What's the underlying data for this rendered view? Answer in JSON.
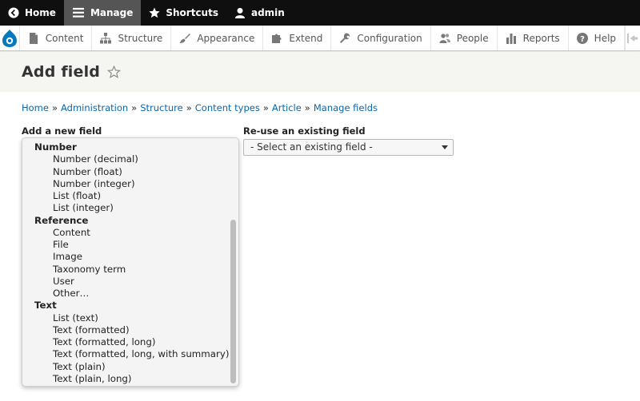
{
  "toolbar": {
    "home": "Home",
    "manage": "Manage",
    "shortcuts": "Shortcuts",
    "user": "admin"
  },
  "tray": {
    "items": [
      {
        "label": "Content",
        "icon": "file-icon"
      },
      {
        "label": "Structure",
        "icon": "sitemap-icon"
      },
      {
        "label": "Appearance",
        "icon": "paintbrush-icon"
      },
      {
        "label": "Extend",
        "icon": "puzzle-icon"
      },
      {
        "label": "Configuration",
        "icon": "wrench-icon"
      },
      {
        "label": "People",
        "icon": "people-icon"
      },
      {
        "label": "Reports",
        "icon": "bar-chart-icon"
      },
      {
        "label": "Help",
        "icon": "help-icon"
      }
    ]
  },
  "page": {
    "title": "Add field"
  },
  "breadcrumb": [
    "Home",
    "Administration",
    "Structure",
    "Content types",
    "Article",
    "Manage fields"
  ],
  "breadcrumb_separator": "»",
  "form": {
    "add_new_label": "Add a new field",
    "reuse_label": "Re-use an existing field",
    "reuse_selected": "- Select an existing field -"
  },
  "dropdown": {
    "rows": [
      {
        "type": "group",
        "label": "Number"
      },
      {
        "type": "option",
        "label": "Number (decimal)"
      },
      {
        "type": "option",
        "label": "Number (float)"
      },
      {
        "type": "option",
        "label": "Number (integer)"
      },
      {
        "type": "option",
        "label": "List (float)"
      },
      {
        "type": "option",
        "label": "List (integer)"
      },
      {
        "type": "group",
        "label": "Reference"
      },
      {
        "type": "option",
        "label": "Content"
      },
      {
        "type": "option",
        "label": "File"
      },
      {
        "type": "option",
        "label": "Image"
      },
      {
        "type": "option",
        "label": "Taxonomy term"
      },
      {
        "type": "option",
        "label": "User"
      },
      {
        "type": "option",
        "label": "Other…"
      },
      {
        "type": "group",
        "label": "Text"
      },
      {
        "type": "option",
        "label": "List (text)"
      },
      {
        "type": "option",
        "label": "Text (formatted)"
      },
      {
        "type": "option",
        "label": "Text (formatted, long)"
      },
      {
        "type": "option",
        "label": "Text (formatted, long, with summary)"
      },
      {
        "type": "option",
        "label": "Text (plain)"
      },
      {
        "type": "option",
        "label": "Text (plain, long)"
      }
    ]
  },
  "colors": {
    "toolbar_bg": "#0f0f0f",
    "manage_active_bg": "#555555",
    "link": "#0a66b0",
    "drupal_blue": "#0678be",
    "header_bg": "#f5f5f2"
  }
}
